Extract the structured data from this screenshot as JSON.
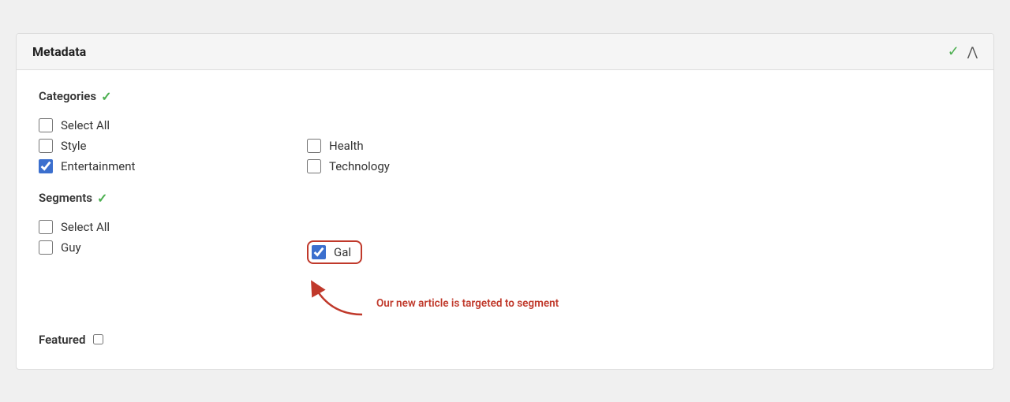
{
  "header": {
    "title": "Metadata",
    "check_icon": "✓",
    "chevron_icon": "^"
  },
  "categories": {
    "section_label": "Categories",
    "check_icon": "✓",
    "select_all_label": "Select All",
    "items_left": [
      {
        "id": "style",
        "label": "Style",
        "checked": false
      },
      {
        "id": "entertainment",
        "label": "Entertainment",
        "checked": true
      }
    ],
    "items_right": [
      {
        "id": "health",
        "label": "Health",
        "checked": false
      },
      {
        "id": "technology",
        "label": "Technology",
        "checked": false
      }
    ]
  },
  "segments": {
    "section_label": "Segments",
    "check_icon": "✓",
    "select_all_label": "Select All",
    "items_left": [
      {
        "id": "guy",
        "label": "Guy",
        "checked": false
      }
    ],
    "items_right": [
      {
        "id": "gal",
        "label": "Gal",
        "checked": true
      }
    ]
  },
  "featured": {
    "label": "Featured",
    "checked": false
  },
  "annotation": {
    "text": "Our new article is targeted to segment"
  }
}
